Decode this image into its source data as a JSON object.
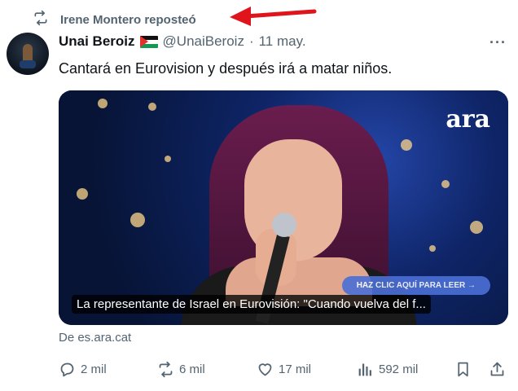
{
  "repost": {
    "label": "Irene Montero reposteó"
  },
  "tweet": {
    "author_name": "Unai Beroiz",
    "flag_emoji": "palestine-flag",
    "handle": "@UnaiBeroiz",
    "separator": "·",
    "date": "11 may.",
    "text": "Cantará en Eurovision y después irá a matar niños.",
    "more": "···"
  },
  "media": {
    "logo": "ara",
    "overlay_button": "HAZ CLIC AQUÍ PARA LEER →",
    "caption": "La representante de Israel en Eurovisión: \"Cuando vuelva del f..."
  },
  "source": "De es.ara.cat",
  "actions": {
    "replies": "2 mil",
    "reposts": "6 mil",
    "likes": "17 mil",
    "views": "592 mil"
  },
  "colors": {
    "muted": "#536471",
    "text": "#0f1419",
    "annotation": "#e0141b"
  }
}
